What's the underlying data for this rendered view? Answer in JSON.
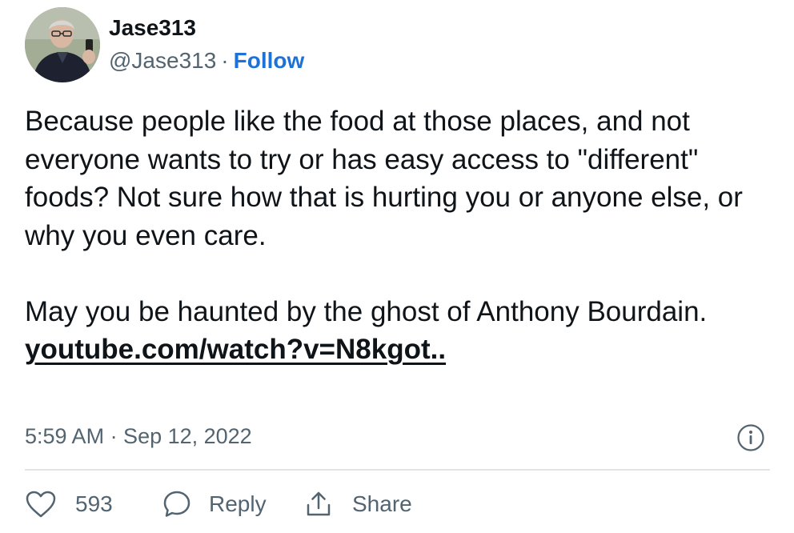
{
  "author": {
    "display_name": "Jase313",
    "handle": "@Jase313",
    "separator": "·",
    "follow_label": "Follow",
    "avatar_icon": "profile-photo"
  },
  "tweet": {
    "paragraph_1": "Because people like the food at those places, and not everyone wants to try or has easy access to \"different\" foods? Not sure how that is hurting you or anyone else, or why you even care.",
    "paragraph_2": "May you be haunted by the ghost of Anthony Bourdain.",
    "link_text": "youtube.com/watch?v=N8kgot..",
    "timestamp": "5:59 AM · Sep 12, 2022"
  },
  "actions": {
    "like_count": "593",
    "reply_label": "Reply",
    "share_label": "Share",
    "like_icon": "heart-icon",
    "reply_icon": "speech-bubble-icon",
    "share_icon": "share-upload-icon",
    "info_icon": "info-icon"
  },
  "colors": {
    "text": "#0f1419",
    "secondary_text": "#536471",
    "link_blue": "#1d72d8",
    "divider": "#e1e4e7"
  }
}
